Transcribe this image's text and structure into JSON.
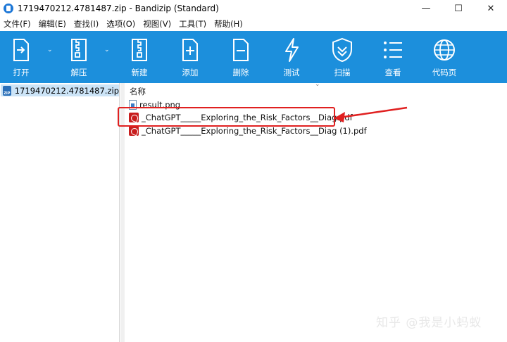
{
  "window": {
    "title": "1719470212.4781487.zip - Bandizip (Standard)",
    "controls": {
      "minimize": "—",
      "maximize": "☐",
      "close": "✕"
    }
  },
  "menu": [
    "文件(F)",
    "编辑(E)",
    "查找(I)",
    "选项(O)",
    "视图(V)",
    "工具(T)",
    "帮助(H)"
  ],
  "toolbar": {
    "open": "打开",
    "extract": "解压",
    "new": "新建",
    "add": "添加",
    "delete": "删除",
    "test": "测试",
    "scan": "扫描",
    "view": "查看",
    "codepage": "代码页",
    "dropdown_glyph": "⌄"
  },
  "tree": {
    "archive": "1719470212.4781487.zip",
    "zip_badge": "ZIP"
  },
  "files": {
    "column_name": "名称",
    "sort_glyph": "⌄",
    "items": [
      {
        "name": "result.png",
        "type": "png"
      },
      {
        "name": "_ChatGPT_____Exploring_the_Risk_Factors__Diag.pdf",
        "type": "pdf"
      },
      {
        "name": "_ChatGPT_____Exploring_the_Risk_Factors__Diag (1).pdf",
        "type": "pdf"
      }
    ]
  },
  "annotation": {
    "color": "#e02020"
  },
  "watermark": "知乎 @我是小蚂蚁",
  "colors": {
    "toolbar": "#1c8fdc",
    "selection": "#cce4f7",
    "pdf": "#c81e1e"
  }
}
